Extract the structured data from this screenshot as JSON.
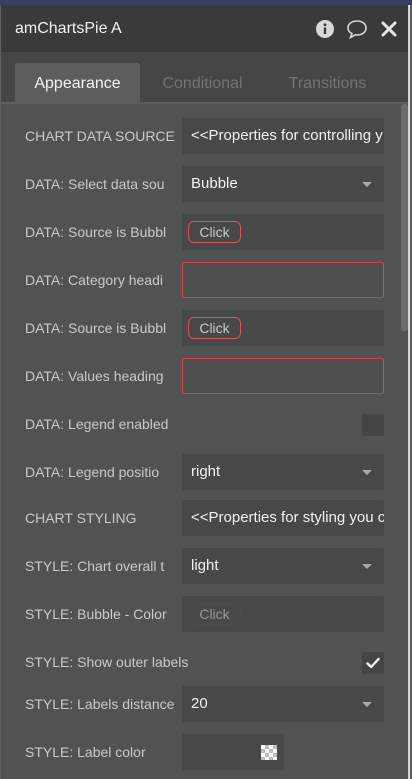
{
  "window": {
    "title": "amChartsPie A",
    "icons": [
      "info-icon",
      "comment-icon",
      "close-icon"
    ]
  },
  "tabs": [
    {
      "label": "Appearance",
      "active": true
    },
    {
      "label": "Conditional",
      "active": false
    },
    {
      "label": "Transitions",
      "active": false
    }
  ],
  "rows": {
    "chart_data_source": {
      "label": "CHART DATA SOURCE",
      "value": "<<Properties for controlling y"
    },
    "select_data_source": {
      "label": "DATA: Select data sou",
      "value": "Bubble"
    },
    "source_bubble_1": {
      "label": "DATA: Source is Bubbl",
      "button": "Click"
    },
    "category_heading": {
      "label": "DATA: Category headi",
      "value": ""
    },
    "source_bubble_2": {
      "label": "DATA: Source is Bubbl",
      "button": "Click"
    },
    "values_heading": {
      "label": "DATA: Values heading",
      "value": ""
    },
    "legend_enabled": {
      "label": "DATA: Legend enabled",
      "checked": false
    },
    "legend_position": {
      "label": "DATA: Legend positio",
      "value": "right"
    },
    "chart_styling": {
      "label": "CHART STYLING",
      "value": "<<Properties for styling you c"
    },
    "chart_theme": {
      "label": "STYLE: Chart overall t",
      "value": "light"
    },
    "bubble_color": {
      "label": "STYLE: Bubble - Color",
      "button": "Click"
    },
    "outer_labels": {
      "label": "STYLE: Show outer labels",
      "checked": true
    },
    "labels_distance": {
      "label": "STYLE: Labels distance",
      "value": "20"
    },
    "label_color": {
      "label": "STYLE: Label color"
    }
  },
  "colors": {
    "error_border": "#d9434b",
    "titlebar_bg": "#3a3a3a",
    "panel_bg": "#515252"
  }
}
